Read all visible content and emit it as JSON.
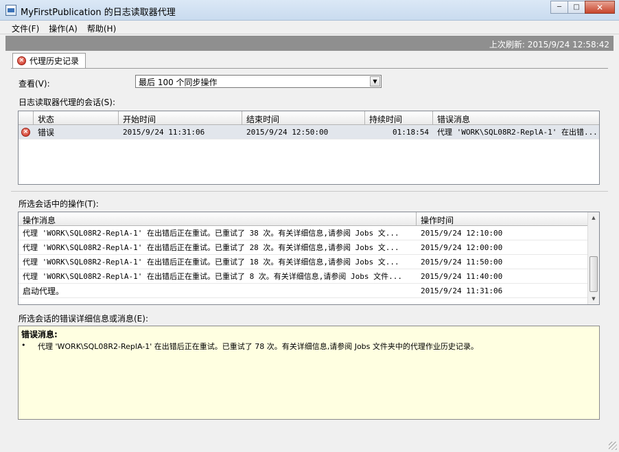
{
  "window": {
    "title": "MyFirstPublication 的日志读取器代理",
    "minimize_glyph": "─",
    "maximize_glyph": "□",
    "close_glyph": "✕"
  },
  "menu": [
    "文件(F)",
    "操作(A)",
    "帮助(H)"
  ],
  "refresh": {
    "text": "上次刷新: 2015/9/24 12:58:42"
  },
  "tab": {
    "label": "代理历史记录",
    "icon": "error-icon"
  },
  "view": {
    "label": "查看(V):",
    "selected": "最后 100 个同步操作"
  },
  "sessions": {
    "label": "日志读取器代理的会话(S):",
    "columns": [
      "状态",
      "开始时间",
      "结束时间",
      "持续时间",
      "错误消息"
    ],
    "rows": [
      {
        "status": "错误",
        "start": "2015/9/24 11:31:06",
        "end": "2015/9/24 12:50:00",
        "duration": "01:18:54",
        "message": "代理 'WORK\\SQL08R2-ReplA-1' 在出错..."
      }
    ]
  },
  "actions": {
    "label": "所选会话中的操作(T):",
    "columns": [
      "操作消息",
      "操作时间"
    ],
    "rows": [
      {
        "message": "代理 'WORK\\SQL08R2-ReplA-1' 在出错后正在重试。已重试了 38 次。有关详细信息,请参阅 Jobs 文...",
        "time": "2015/9/24 12:10:00"
      },
      {
        "message": "代理 'WORK\\SQL08R2-ReplA-1' 在出错后正在重试。已重试了 28 次。有关详细信息,请参阅 Jobs 文...",
        "time": "2015/9/24 12:00:00"
      },
      {
        "message": "代理 'WORK\\SQL08R2-ReplA-1' 在出错后正在重试。已重试了 18 次。有关详细信息,请参阅 Jobs 文...",
        "time": "2015/9/24 11:50:00"
      },
      {
        "message": "代理 'WORK\\SQL08R2-ReplA-1' 在出错后正在重试。已重试了 8 次。有关详细信息,请参阅 Jobs 文件...",
        "time": "2015/9/24 11:40:00"
      },
      {
        "message": "启动代理。",
        "time": "2015/9/24 11:31:06"
      }
    ]
  },
  "details": {
    "label": "所选会话的错误详细信息或消息(E):",
    "title": "错误消息:",
    "bullet": "•",
    "lines": [
      "代理 'WORK\\SQL08R2-ReplA-1' 在出错后正在重试。已重试了 78 次。有关详细信息,请参阅 Jobs 文件夹中的代理作业历史记录。"
    ]
  }
}
